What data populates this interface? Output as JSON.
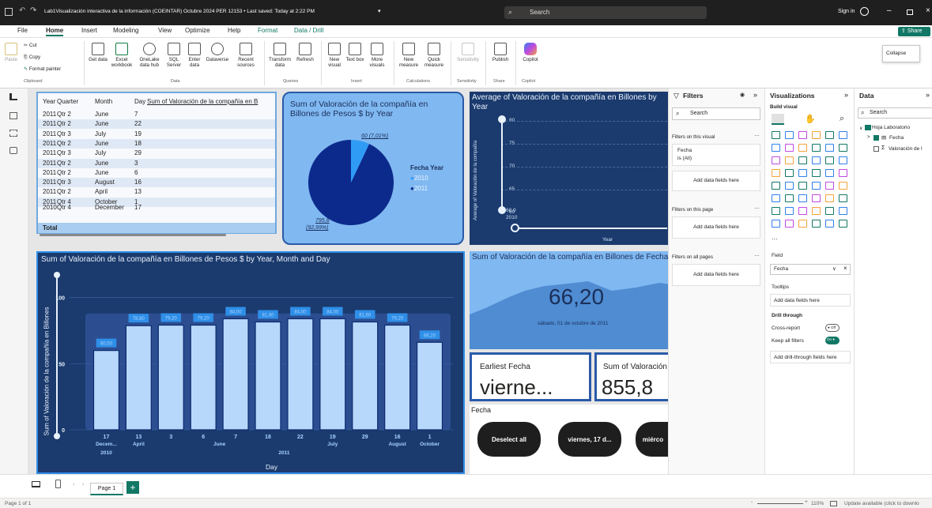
{
  "window": {
    "title": "Lab1Visualización interactiva de la información (COEINTAR) Octubre 2024 PER 12153 • Last saved: Today at 2:22 PM",
    "search_placeholder": "Search",
    "sign_in": "Sign in"
  },
  "ribbon_tabs": [
    "File",
    "Home",
    "Insert",
    "Modeling",
    "View",
    "Optimize",
    "Help",
    "Format",
    "Data / Drill"
  ],
  "share_label": "Share",
  "ribbon": {
    "clipboard": {
      "paste": "Paste",
      "cut": "Cut",
      "copy": "Copy",
      "format_painter": "Format painter",
      "group": "Clipboard"
    },
    "data": {
      "get_data": "Get data",
      "excel": "Excel workbook",
      "onelake": "OneLake data hub",
      "sql": "SQL Server",
      "enter": "Enter data",
      "dataverse": "Dataverse",
      "recent": "Recent sources",
      "group": "Data"
    },
    "queries": {
      "transform": "Transform data",
      "refresh": "Refresh",
      "group": "Queries"
    },
    "insert": {
      "new_visual": "New visual",
      "text_box": "Text box",
      "more_visuals": "More visuals",
      "group": "Insert"
    },
    "calculations": {
      "new_measure": "New measure",
      "quick_measure": "Quick measure",
      "group": "Calculations"
    },
    "sensitivity": {
      "label": "Sensitivity",
      "group": "Sensitivity"
    },
    "share": {
      "publish": "Publish",
      "group": "Share"
    },
    "copilot": {
      "label": "Copilot",
      "group": "Copilot"
    }
  },
  "collapse_tooltip": "Collapse",
  "table_visual": {
    "columns": [
      "Year",
      "Quarter",
      "Month",
      "Day",
      "Sum of Valoración de la compañía en B"
    ],
    "rows": [
      [
        "2011",
        "Qtr 2",
        "June",
        "7",
        ""
      ],
      [
        "2011",
        "Qtr 2",
        "June",
        "22",
        ""
      ],
      [
        "2011",
        "Qtr 3",
        "July",
        "19",
        ""
      ],
      [
        "2011",
        "Qtr 2",
        "June",
        "18",
        ""
      ],
      [
        "2011",
        "Qtr 3",
        "July",
        "29",
        ""
      ],
      [
        "2011",
        "Qtr 2",
        "June",
        "3",
        ""
      ],
      [
        "2011",
        "Qtr 2",
        "June",
        "6",
        ""
      ],
      [
        "2011",
        "Qtr 3",
        "August",
        "16",
        ""
      ],
      [
        "2011",
        "Qtr 2",
        "April",
        "13",
        ""
      ],
      [
        "2011",
        "Qtr 4",
        "October",
        "1",
        ""
      ],
      [
        "2010",
        "Qtr 4",
        "December",
        "17",
        ""
      ]
    ],
    "total_label": "Total"
  },
  "pie_visual": {
    "title": "Sum of Valoración de la compañía en Billones de Pesos $ by Year",
    "legend_title": "Fecha Year",
    "legend": [
      "2010",
      "2011"
    ],
    "label_small": "60 (7,01%)",
    "label_large_value": "795,8",
    "label_large_pct": "(92,99%)",
    "colors": {
      "2010": "#2f9bf5",
      "2011": "#0c2a8c"
    }
  },
  "line_visual": {
    "title": "Average of Valoración de la compañía en Billones by Year",
    "ylabel": "Average of Valoración de la compañía",
    "xlabel": "Year",
    "yticks": [
      "80",
      "75",
      "70",
      "65",
      "60"
    ],
    "x_point_label": "2010",
    "point_value": "60.0"
  },
  "bar_visual": {
    "title": "Sum of Valoración de la compañía en Billones de Pesos $ by Year, Month and Day",
    "ylabel": "Sum of Valoración de la compañía en Billones",
    "xlabel": "Day",
    "yticks": [
      "100",
      "50",
      "0"
    ],
    "month_labels": [
      "Decem...",
      "April",
      "June",
      "July",
      "August",
      "October"
    ],
    "year_labels": [
      "2010",
      "2011"
    ]
  },
  "chart_data": {
    "type": "bar",
    "title": "Sum of Valoración de la compañía en Billones de Pesos $ by Year, Month and Day",
    "xlabel": "Day",
    "ylabel": "Sum of Valoración de la compañía en Billones",
    "categories": [
      "17",
      "13",
      "3",
      "6",
      "7",
      "18",
      "22",
      "19",
      "29",
      "16",
      "1"
    ],
    "values": [
      60.0,
      78.8,
      79.2,
      79.2,
      84.0,
      81.6,
      84.0,
      84.0,
      81.6,
      79.2,
      66.2
    ],
    "value_labels": [
      "60,00",
      "78,80",
      "79,20",
      "79,20",
      "84,00",
      "81,60",
      "84,00",
      "84,00",
      "81,60",
      "79,20",
      "66,20"
    ],
    "ylim": [
      0,
      110
    ]
  },
  "area_card": {
    "title": "Sum of Valoración de la compañía en Billones de Fecha",
    "value": "66,20",
    "subtitle": "sábado, 01 de octubre de 2011"
  },
  "card_earliest": {
    "label": "Earliest Fecha",
    "value": "vierne..."
  },
  "card_sum": {
    "label": "Sum of Valoración",
    "value": "855,8"
  },
  "slicer": {
    "title": "Fecha",
    "buttons": [
      "Deselect all",
      "viernes, 17 d...",
      "miérco"
    ]
  },
  "filters": {
    "title": "Filters",
    "search": "Search",
    "on_this_visual": "Filters on this visual",
    "fecha_label": "Fecha",
    "fecha_state": "is (All)",
    "add_fields": "Add data fields here",
    "on_this_page": "Filters on this page",
    "on_all_pages": "Filters on all pages"
  },
  "visualizations": {
    "title": "Visualizations",
    "build_visual": "Build visual",
    "field_label": "Field",
    "field_value": "Fecha",
    "tooltips": "Tooltips",
    "add_fields": "Add data fields here",
    "drill_through": "Drill through",
    "cross_report": "Cross-report",
    "cross_state": "Off",
    "keep_filters": "Keep all filters",
    "keep_state": "On",
    "add_drill": "Add drill-through fields here"
  },
  "data_pane": {
    "title": "Data",
    "search": "Search",
    "table": "Hoja Laboratorio",
    "field1": "Fecha",
    "field2": "Valoración de l"
  },
  "pages": {
    "current": "Page 1"
  },
  "status": {
    "page": "Page 1 of 1",
    "zoom": "110%",
    "update": "Update available (click to downlo"
  }
}
